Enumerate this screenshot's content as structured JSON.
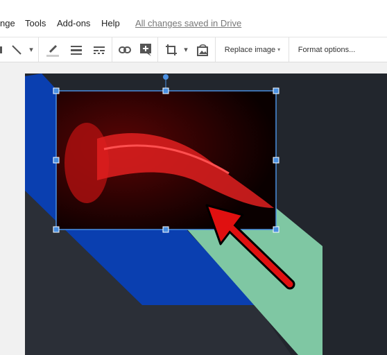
{
  "menu": {
    "items": [
      "nge",
      "Tools",
      "Add-ons",
      "Help"
    ],
    "saved_status": "All changes saved in Drive"
  },
  "toolbar": {
    "icons": [
      "shape-icon",
      "line-icon",
      "dropdown-icon",
      "pen-color-icon",
      "border-weight-icon",
      "border-dash-icon",
      "link-icon",
      "add-comment-icon",
      "crop-icon",
      "dropdown-icon",
      "reset-image-icon"
    ],
    "replace_image": "Replace image",
    "format_options": "Format options..."
  },
  "colors": {
    "slide_bg": "#22262d",
    "blue_band": "#0a3fb0",
    "green_band": "#7fc7a3",
    "selection": "#4a90e2",
    "arrow": "#e01010"
  }
}
